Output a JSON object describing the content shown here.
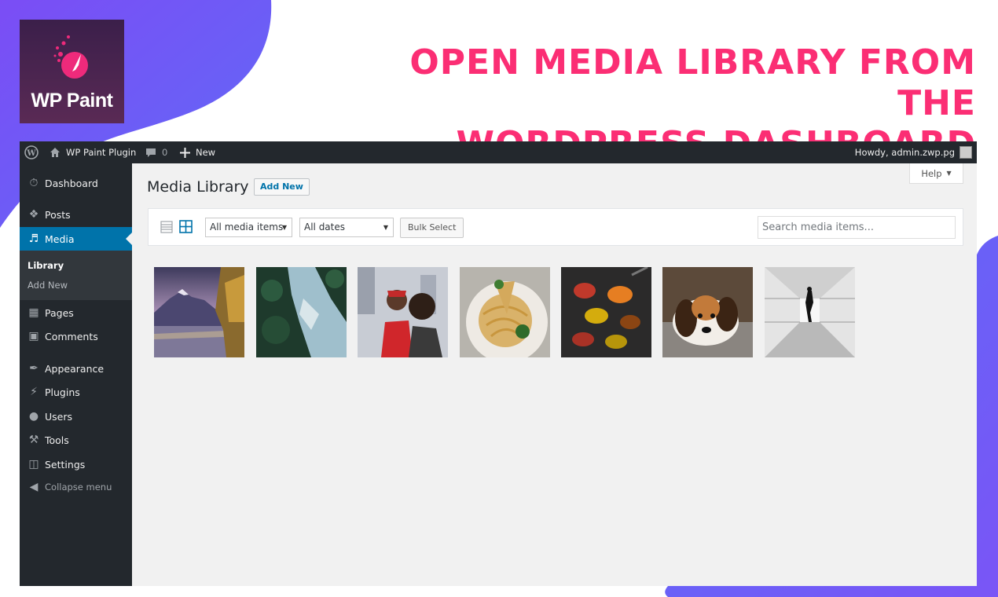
{
  "branding": {
    "logo_text": "WP Paint",
    "headline_line1": "OPEN MEDIA LIBRARY FROM THE",
    "headline_line2": "WORDPRESS DASHBOARD",
    "accent_color": "#fb2e74",
    "blob_color": "#6b5cf7"
  },
  "adminbar": {
    "site_name": "WP Paint Plugin",
    "comments_count": "0",
    "new_label": "New",
    "howdy": "Howdy, admin.zwp.pg"
  },
  "sidebar": {
    "items": [
      {
        "label": "Dashboard",
        "icon": "dashboard-icon"
      },
      {
        "label": "Posts",
        "icon": "pin-icon"
      },
      {
        "label": "Media",
        "icon": "media-icon",
        "active": true
      },
      {
        "label": "Pages",
        "icon": "pages-icon"
      },
      {
        "label": "Comments",
        "icon": "comment-icon"
      },
      {
        "label": "Appearance",
        "icon": "brush-icon"
      },
      {
        "label": "Plugins",
        "icon": "plugin-icon"
      },
      {
        "label": "Users",
        "icon": "user-icon"
      },
      {
        "label": "Tools",
        "icon": "wrench-icon"
      },
      {
        "label": "Settings",
        "icon": "settings-icon"
      }
    ],
    "submenu": [
      "Library",
      "Add New"
    ],
    "collapse_label": "Collapse menu"
  },
  "main": {
    "help_label": "Help",
    "title": "Media Library",
    "add_new_label": "Add New",
    "filter_type": "All media items",
    "filter_date": "All dates",
    "bulk_select_label": "Bulk Select",
    "search_placeholder": "Search media items...",
    "thumbnails": [
      "mountain lake landscape",
      "aerial river forest",
      "two women selfie",
      "spaghetti plate",
      "spices on spoons",
      "beagle puppy",
      "silhouette in tunnel"
    ]
  }
}
